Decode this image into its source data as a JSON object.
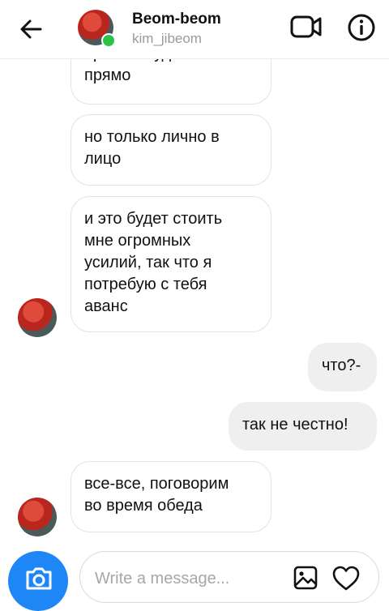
{
  "header": {
    "title": "Beom-beom",
    "subtitle": "kim_jibeom",
    "accent_online": "#2bc24a"
  },
  "messages": [
    {
      "side": "them",
      "text": "прямо - будет\nпрямо"
    },
    {
      "side": "them",
      "text": "но только лично в\nлицо"
    },
    {
      "side": "them",
      "text": "и это будет стоить\nмне огромных\nусилий, так что я\nпотребую с тебя\nаванс"
    },
    {
      "side": "me",
      "text": "что?-"
    },
    {
      "side": "me",
      "text": "так не честно!"
    },
    {
      "side": "them",
      "text": "все-все, поговорим\nво время обеда"
    }
  ],
  "composer": {
    "placeholder": "Write a message...",
    "camera_color": "#1f86f5"
  },
  "icons": [
    "back-arrow-icon",
    "video-call-icon",
    "info-icon",
    "camera-icon",
    "gallery-icon",
    "heart-icon"
  ]
}
